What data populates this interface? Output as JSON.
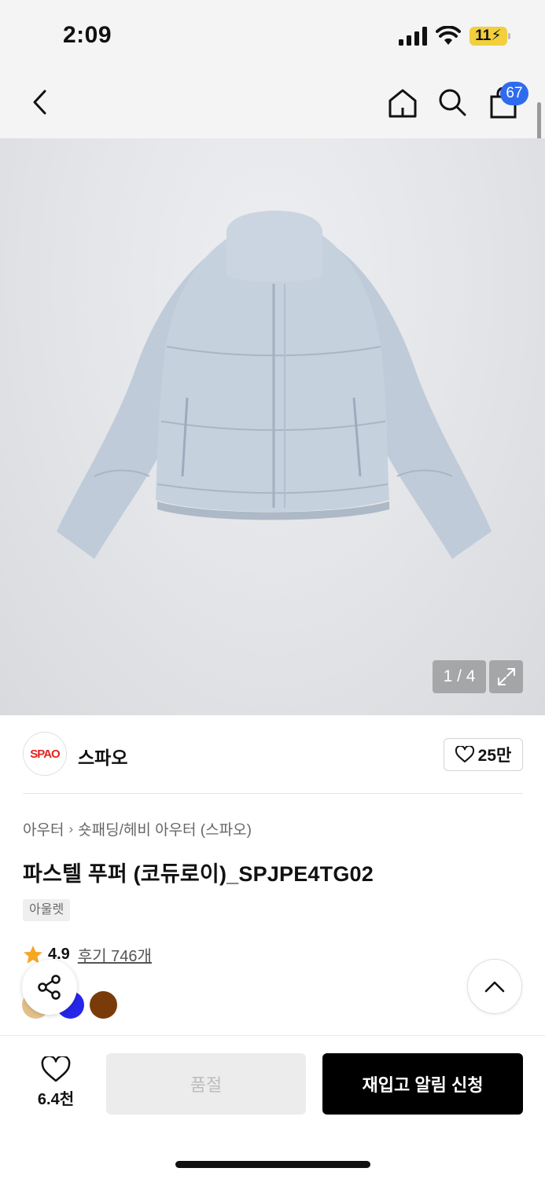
{
  "status_bar": {
    "time": "2:09",
    "battery": "11"
  },
  "nav": {
    "cart_count": "67"
  },
  "gallery": {
    "counter": "1 / 4"
  },
  "brand": {
    "logo_text": "SPAO",
    "name": "스파오",
    "like_count": "25만"
  },
  "product": {
    "breadcrumb": [
      "아우터",
      "숏패딩/헤비 아우터 (스파오)"
    ],
    "title": "파스텔 푸퍼 (코듀로이)_SPJPE4TG02",
    "tag": "아울렛",
    "rating": "4.9",
    "review_link": "후기 746개",
    "swatches": [
      "#e2c189",
      "#2626e8",
      "#7a3b0b"
    ]
  },
  "bottom_bar": {
    "wish_count": "6.4천",
    "soldout_label": "품절",
    "restock_label": "재입고 알림 신청"
  },
  "colors": {
    "accent": "#2f6bef",
    "star": "#f5a623",
    "brand_red": "#e1241f"
  }
}
